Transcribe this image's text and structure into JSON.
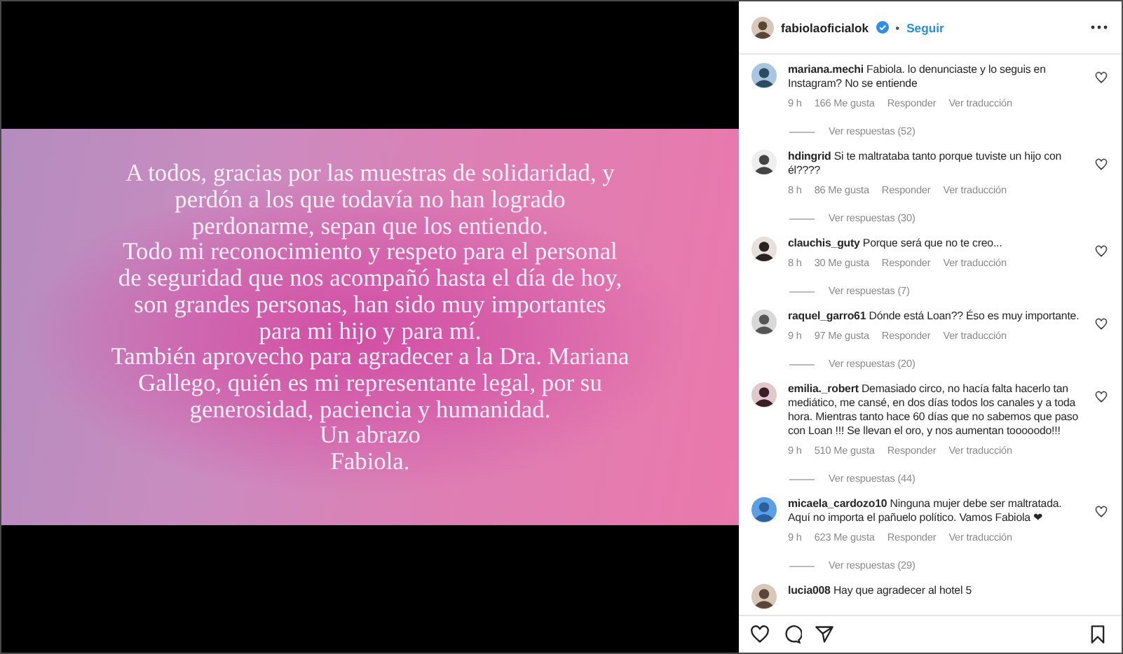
{
  "post": {
    "message_lines": [
      "A todos, gracias por las muestras de solidaridad, y",
      "perdón a los que todavía no han logrado",
      "perdonarme, sepan que los entiendo.",
      "Todo mi reconocimiento y respeto para el personal",
      "de seguridad que nos acompañó hasta el día de hoy,",
      "son grandes personas, han sido muy importantes",
      "para mi hijo y para mí.",
      "También aprovecho para agradecer a la Dra. Mariana",
      "Gallego, quién es mi representante legal, por su",
      "generosidad, paciencia y humanidad.",
      "Un abrazo",
      "Fabiola."
    ]
  },
  "header": {
    "username": "fabiolaoficialok",
    "verified": true,
    "separator": "•",
    "follow": "Seguir"
  },
  "comments": [
    {
      "username": "mariana.mechi",
      "text": "Fabiola. lo denunciaste y lo seguis en Instagram? No se entiende",
      "time": "9 h",
      "likes": "166 Me gusta",
      "reply": "Responder",
      "translate": "Ver traducción",
      "replies": "Ver respuestas (52)"
    },
    {
      "username": "hdingrid",
      "text": "Si te maltrataba tanto porque tuviste un hijo con él????",
      "time": "8 h",
      "likes": "86 Me gusta",
      "reply": "Responder",
      "translate": "Ver traducción",
      "replies": "Ver respuestas (30)"
    },
    {
      "username": "clauchis_guty",
      "text": "Porque será que no te creo...",
      "time": "8 h",
      "likes": "30 Me gusta",
      "reply": "Responder",
      "translate": "Ver traducción",
      "replies": "Ver respuestas (7)"
    },
    {
      "username": "raquel_garro61",
      "text": "Dónde está Loan?? Éso es muy importante.",
      "time": "9 h",
      "likes": "97 Me gusta",
      "reply": "Responder",
      "translate": "Ver traducción",
      "replies": "Ver respuestas (20)"
    },
    {
      "username": "emilia._robert",
      "text": "Demasiado circo, no hacía falta hacerlo tan mediático, me cansé, en dos días todos los canales y a toda hora. Mientras tanto hace 60 días que no sabemos que paso con Loan !!! Se llevan el oro, y nos aumentan tooooodo!!!",
      "time": "9 h",
      "likes": "510 Me gusta",
      "reply": "Responder",
      "translate": "Ver traducción",
      "replies": "Ver respuestas (44)"
    },
    {
      "username": "micaela_cardozo10",
      "text": "Ninguna mujer debe ser maltratada. Aquí no importa el pañuelo político. Vamos Fabiola ❤",
      "time": "9 h",
      "likes": "623 Me gusta",
      "reply": "Responder",
      "translate": "Ver traducción",
      "replies": "Ver respuestas (29)"
    },
    {
      "username": "lucia008",
      "text": "Hay que agradecer al hotel 5"
    }
  ]
}
